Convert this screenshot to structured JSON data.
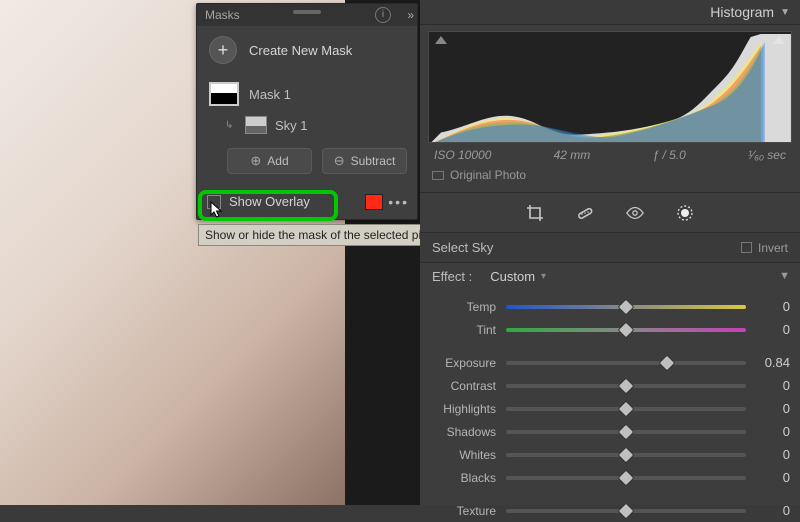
{
  "masks_panel": {
    "title": "Masks",
    "create_label": "Create New Mask",
    "mask1_label": "Mask 1",
    "sky_label": "Sky 1",
    "add_label": "Add",
    "subtract_label": "Subtract",
    "show_overlay_label": "Show Overlay",
    "overlay_color": "#ff2a16"
  },
  "tooltip": "Show or hide the mask of the selected pin (O)",
  "histogram": {
    "title": "Histogram",
    "iso": "ISO 10000",
    "focal": "42 mm",
    "aperture": "ƒ / 5.0",
    "shutter": "¹⁄₆₀ sec",
    "original_label": "Original Photo"
  },
  "mask_section": {
    "select_label": "Select Sky",
    "invert_label": "Invert",
    "effect_label": "Effect :",
    "effect_value": "Custom"
  },
  "sliders": [
    {
      "label": "Temp",
      "value": "0",
      "pos": 50,
      "track": "temp"
    },
    {
      "label": "Tint",
      "value": "0",
      "pos": 50,
      "track": "tint"
    },
    {
      "label": "Exposure",
      "value": "0.84",
      "pos": 67,
      "track": ""
    },
    {
      "label": "Contrast",
      "value": "0",
      "pos": 50,
      "track": ""
    },
    {
      "label": "Highlights",
      "value": "0",
      "pos": 50,
      "track": ""
    },
    {
      "label": "Shadows",
      "value": "0",
      "pos": 50,
      "track": ""
    },
    {
      "label": "Whites",
      "value": "0",
      "pos": 50,
      "track": ""
    },
    {
      "label": "Blacks",
      "value": "0",
      "pos": 50,
      "track": ""
    },
    {
      "label": "Texture",
      "value": "0",
      "pos": 50,
      "track": ""
    }
  ]
}
